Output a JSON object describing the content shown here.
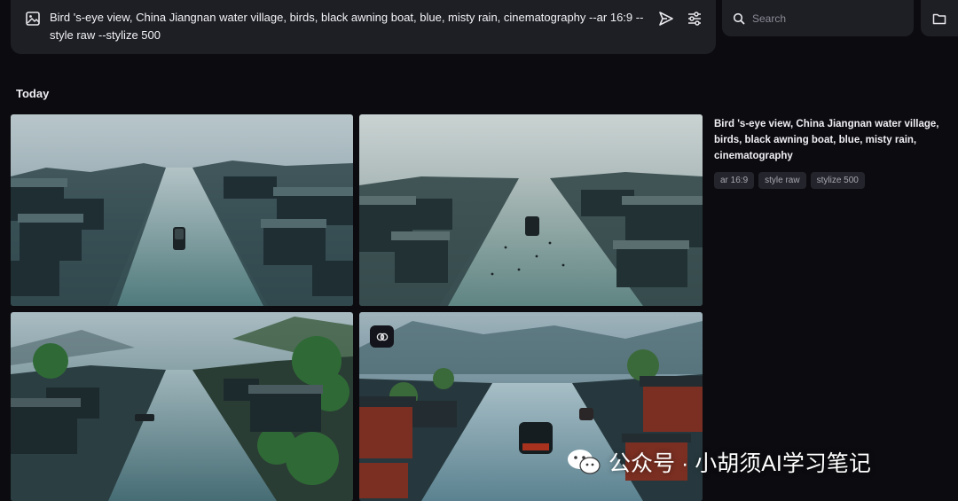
{
  "prompt": {
    "text": "Bird 's-eye view, China Jiangnan water village, birds, black awning boat, blue, misty rain, cinematography --ar 16:9 --style raw --stylize 500"
  },
  "search": {
    "placeholder": "Search"
  },
  "section": {
    "title": "Today"
  },
  "details": {
    "prompt": "Bird 's-eye view, China Jiangnan water village, birds, black awning boat, blue, misty rain, cinematography",
    "tags": [
      "ar 16:9",
      "style raw",
      "stylize 500"
    ]
  },
  "watermark": {
    "text": "公众号 · 小胡须AI学习笔记"
  },
  "icons": {
    "prompt": "image-icon",
    "send": "send-icon",
    "settings": "sliders-icon",
    "search": "search-icon",
    "folder": "folder-icon",
    "badge": "brain-icon"
  },
  "colors": {
    "background": "#0c0c10",
    "panel": "#1e1f25",
    "tag": "#24252c"
  }
}
